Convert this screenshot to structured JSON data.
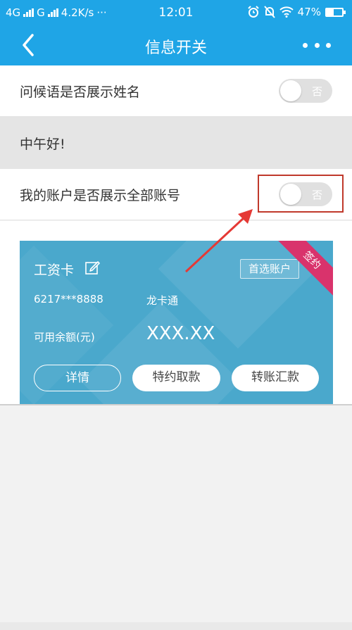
{
  "status_bar": {
    "network_1": "4G",
    "network_2": "G",
    "speed": "4.2K/s",
    "dots": "···",
    "time": "12:01",
    "battery": "47%"
  },
  "navbar": {
    "title": "信息开关",
    "back_icon": "chevron-left-icon",
    "more_icon": "more-dots-icon"
  },
  "settings": {
    "greeting_name": {
      "label": "问候语是否展示姓名",
      "toggle_text": "否",
      "on": false
    },
    "greeting_preview": "中午好!",
    "all_accounts": {
      "label": "我的账户是否展示全部账号",
      "toggle_text": "否",
      "on": false
    }
  },
  "card": {
    "name": "工资卡",
    "preferred_label": "首选账户",
    "ribbon": "签约",
    "number": "6217***8888",
    "type": "龙卡通",
    "balance_label": "可用余额(元)",
    "balance_value": "XXX.XX",
    "buttons": {
      "detail": "详情",
      "special": "特约取款",
      "transfer": "转账汇款"
    }
  },
  "colors": {
    "header": "#1fa5e6",
    "card": "#4aa8cc",
    "ribbon": "#d9336c",
    "annotation": "#e53935"
  }
}
